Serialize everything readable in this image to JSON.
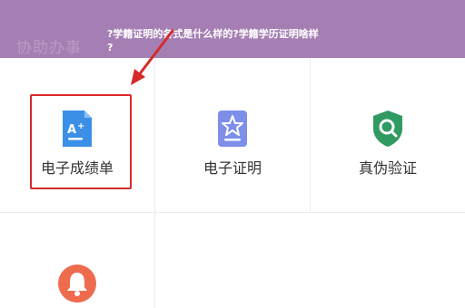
{
  "header": {
    "title": "协助办事",
    "overlay_line1": "?学籍证明的各式是什么样的?学籍学历证明啥样",
    "overlay_line2": "?"
  },
  "tiles": [
    {
      "label": "电子成绩单",
      "icon": "grade-document-icon",
      "color": "#3b8fe6"
    },
    {
      "label": "电子证明",
      "icon": "certificate-star-icon",
      "color": "#7d8fe8"
    },
    {
      "label": "真伪验证",
      "icon": "verify-shield-icon",
      "color": "#2f9a62"
    },
    {
      "label": "",
      "icon": "bell-icon",
      "color": "#ee6b4d"
    }
  ],
  "colors": {
    "header": "#a57fb3",
    "highlight": "#d62a2a"
  }
}
